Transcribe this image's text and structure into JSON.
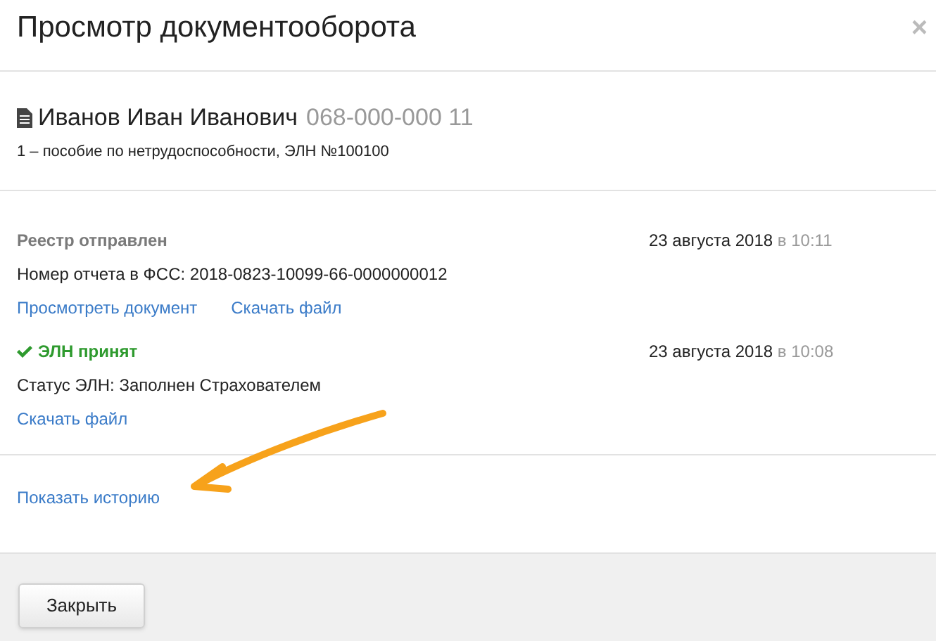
{
  "dialog": {
    "title": "Просмотр документооборота",
    "close": "×"
  },
  "person": {
    "name": "Иванов Иван Иванович",
    "snils": "068-000-000 11",
    "subtitle": "1 – пособие по нетрудоспособности, ЭЛН №100100"
  },
  "events": [
    {
      "kind": "sent",
      "status": "Реестр отправлен",
      "date": "23 августа 2018",
      "at": "в",
      "time": "10:11",
      "detail": "Номер отчета в ФСС: 2018-0823-10099-66-0000000012",
      "links": [
        "Просмотреть документ",
        "Скачать файл"
      ]
    },
    {
      "kind": "accepted",
      "status": "ЭЛН принят",
      "date": "23 августа 2018",
      "at": "в",
      "time": "10:08",
      "detail": "Статус ЭЛН: Заполнен Страхователем",
      "links": [
        "Скачать файл"
      ]
    }
  ],
  "history_link": "Показать историю",
  "buttons": [
    "Закрыть"
  ]
}
